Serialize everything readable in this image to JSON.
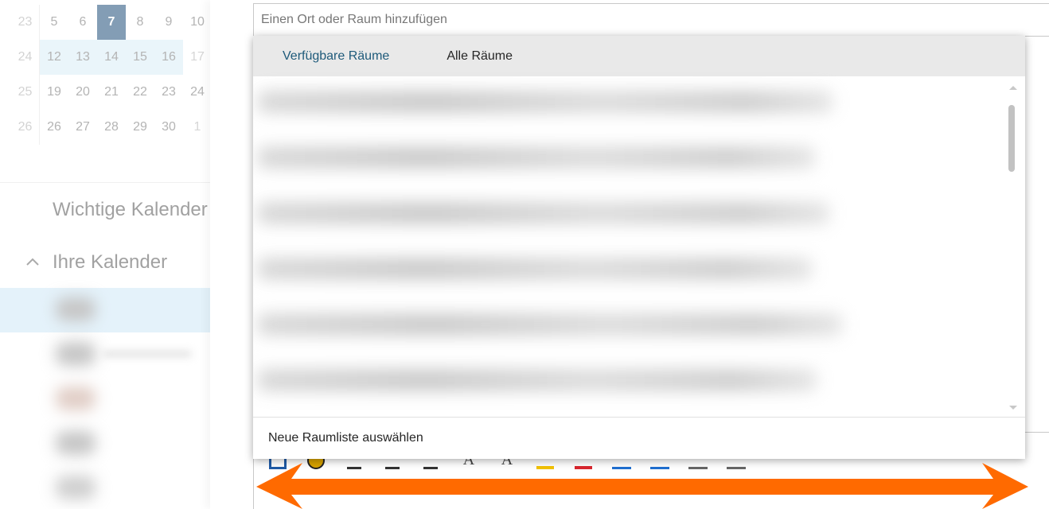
{
  "sidebar": {
    "mini_calendar": {
      "rows": [
        {
          "week": "23",
          "days": [
            "5",
            "6",
            "7",
            "8",
            "9",
            "10"
          ]
        },
        {
          "week": "24",
          "days": [
            "12",
            "13",
            "14",
            "15",
            "16",
            "17"
          ]
        },
        {
          "week": "25",
          "days": [
            "19",
            "20",
            "21",
            "22",
            "23",
            "24"
          ]
        },
        {
          "week": "26",
          "days": [
            "26",
            "27",
            "28",
            "29",
            "30",
            "1"
          ]
        }
      ],
      "selected_day": "7"
    },
    "important_calendars_label": "Wichtige Kalender",
    "your_calendars_label": "Ihre Kalender"
  },
  "event_form": {
    "location_placeholder": "Einen Ort oder Raum hinzufügen"
  },
  "room_dropdown": {
    "tabs": [
      {
        "label": "Verfügbare Räume",
        "active": true
      },
      {
        "label": "Alle Räume",
        "active": false
      }
    ],
    "footer_label": "Neue Raumliste auswählen"
  },
  "colors": {
    "accent_tab": "#1e5a7a",
    "selected_day": "#1e4e79",
    "annotation_arrow": "#ff6a00"
  }
}
